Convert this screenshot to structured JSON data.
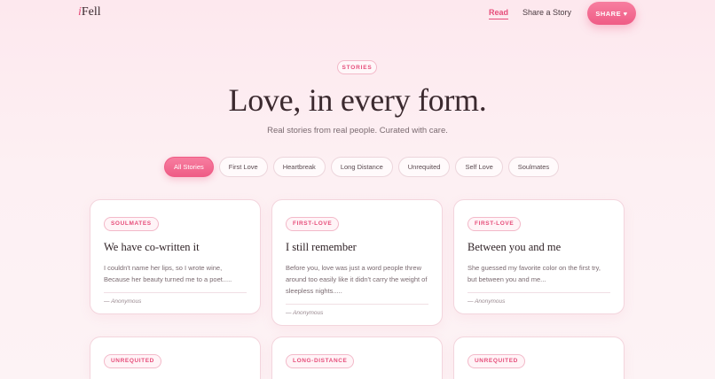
{
  "header": {
    "logo_i": "i",
    "logo_rest": "Fell",
    "nav_read": "Read",
    "nav_share": "Share a Story",
    "share_button": "SHARE ♥"
  },
  "hero": {
    "eyebrow": "STORIES",
    "title": "Love, in every form.",
    "subtitle": "Real stories from real people. Curated with care."
  },
  "filters": [
    "All Stories",
    "First Love",
    "Heartbreak",
    "Long Distance",
    "Unrequited",
    "Self Love",
    "Soulmates"
  ],
  "active_filter": "All Stories",
  "cards": [
    {
      "tag": "SOULMATES",
      "title": "We have co-written it",
      "excerpt": "I couldn't name her lips, so I wrote wine, Because her beauty turned me to a poet.....",
      "author": "— Anonymous"
    },
    {
      "tag": "FIRST-LOVE",
      "title": "I still remember",
      "excerpt": "Before you, love was just a word people threw around too easily like it didn't carry the weight of sleepless nights.....",
      "author": "— Anonymous"
    },
    {
      "tag": "FIRST-LOVE",
      "title": "Between you and me",
      "excerpt": "She guessed my favorite color on the first try, but between you and me...",
      "author": "— Anonymous"
    },
    {
      "tag": "UNREQUITED"
    },
    {
      "tag": "LONG-DISTANCE"
    },
    {
      "tag": "UNREQUITED"
    }
  ],
  "colors": {
    "accent": "#e64d7a",
    "background": "#fde8ee",
    "text": "#3b2a2f"
  }
}
